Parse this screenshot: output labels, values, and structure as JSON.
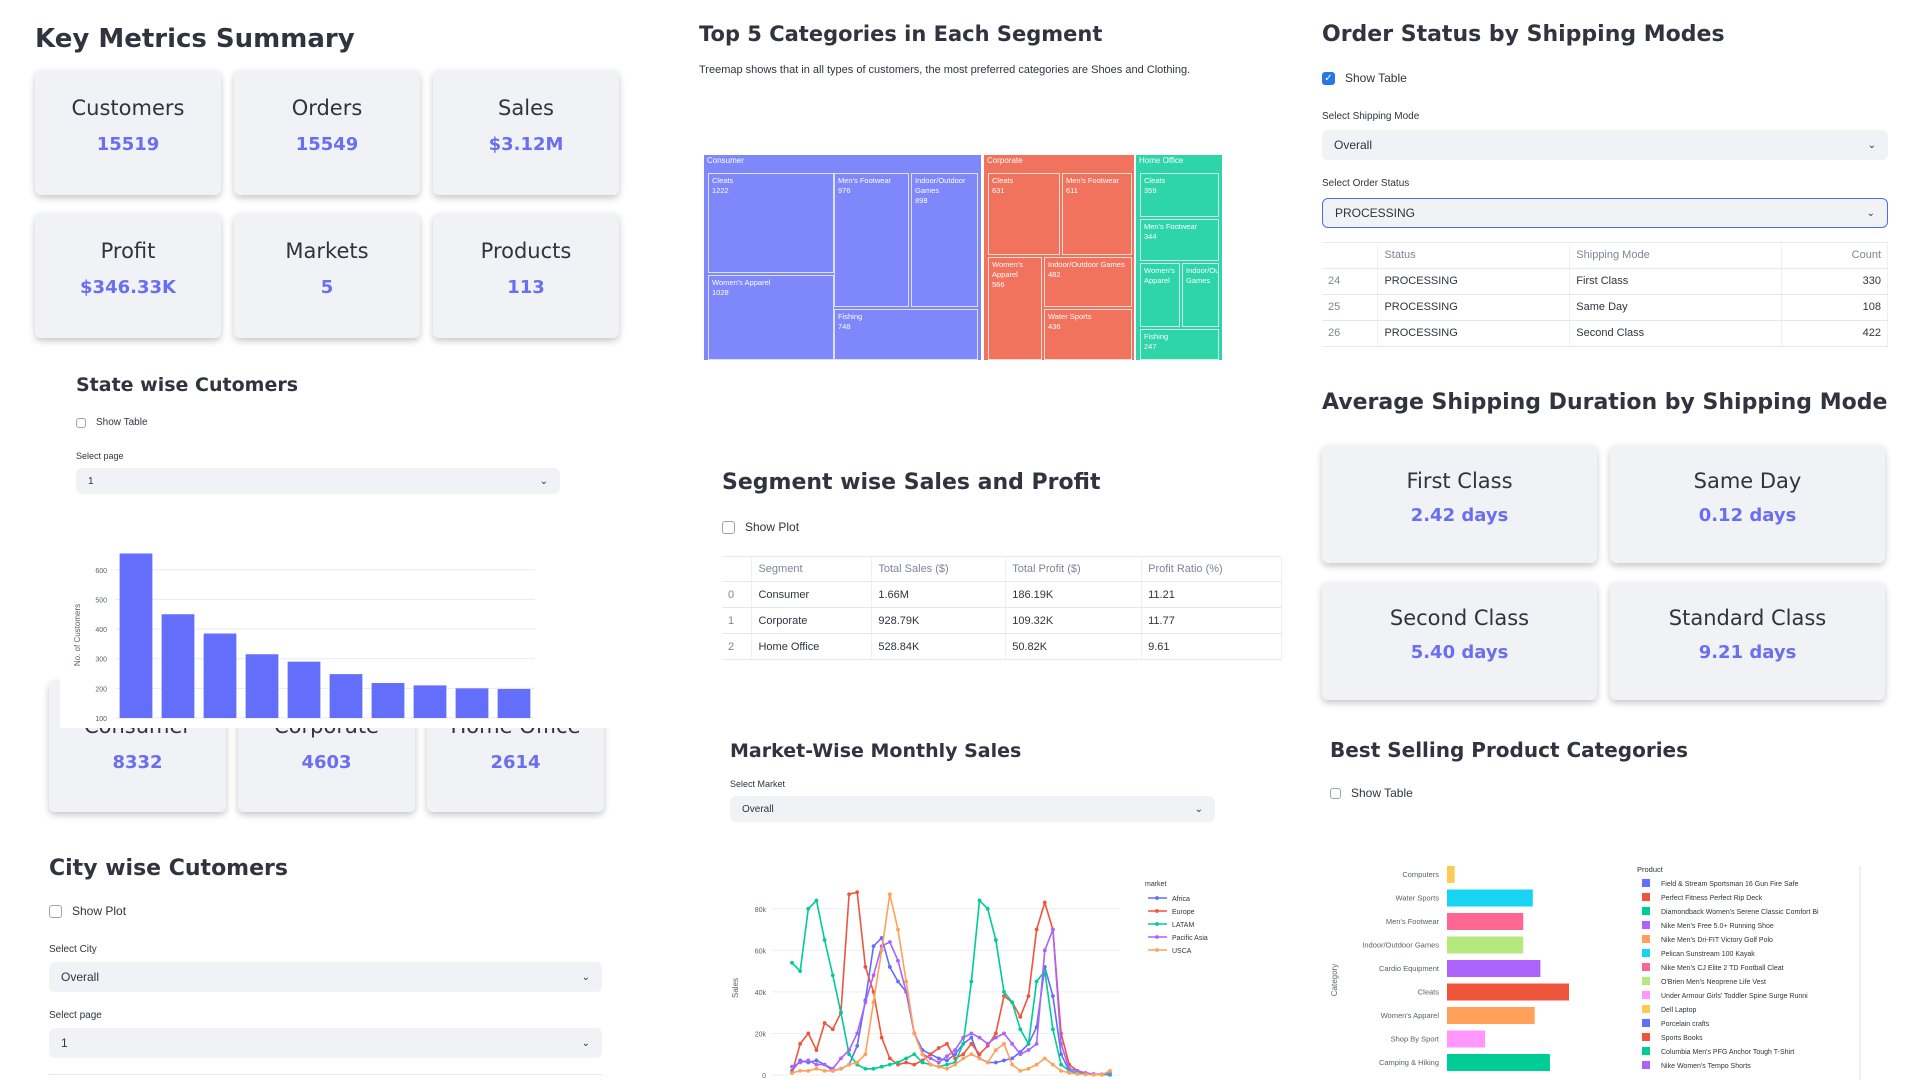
{
  "key_metrics": {
    "title": "Key Metrics Summary",
    "cards": [
      {
        "label": "Customers",
        "value": "15519"
      },
      {
        "label": "Orders",
        "value": "15549"
      },
      {
        "label": "Sales",
        "value": "$3.12M"
      },
      {
        "label": "Profit",
        "value": "$346.33K"
      },
      {
        "label": "Markets",
        "value": "5"
      },
      {
        "label": "Products",
        "value": "113"
      }
    ]
  },
  "state_customers": {
    "title": "State wise Cutomers",
    "show_table_label": "Show Table",
    "select_page_label": "Select page",
    "select_page_value": "1",
    "chart_data": {
      "type": "bar",
      "ylabel": "No. of Customers",
      "yticks": [
        "100",
        "200",
        "300",
        "400",
        "500",
        "600"
      ],
      "ylim": [
        100,
        660
      ],
      "values": [
        655,
        450,
        385,
        315,
        290,
        248,
        218,
        210,
        200,
        198
      ]
    }
  },
  "segment_cards": [
    {
      "label": "Consumer",
      "value": "8332"
    },
    {
      "label": "Corporate",
      "value": "4603"
    },
    {
      "label": "Home Office",
      "value": "2614"
    }
  ],
  "city_customers": {
    "title": "City wise Cutomers",
    "show_plot_label": "Show Plot",
    "select_city_label": "Select City",
    "select_city_value": "Overall",
    "select_page_label": "Select page",
    "select_page_value": "1"
  },
  "treemap": {
    "title": "Top 5 Categories in Each Segment",
    "description": "Treemap shows that in all types of customers, the most preferred categories are Shoes and Clothing.",
    "colors": {
      "Consumer": "#636efa",
      "Corporate": "#ef553b",
      "Home Office": "#00cc96"
    },
    "segments": [
      {
        "name": "Consumer",
        "cells": [
          {
            "label": "Cleats",
            "value": "1222"
          },
          {
            "label": "Men's Footwear",
            "value": "976"
          },
          {
            "label": "Indoor/Outdoor Games",
            "value": "898"
          },
          {
            "label": "Women's Apparel",
            "value": "1028"
          },
          {
            "label": "Fishing",
            "value": "748"
          }
        ]
      },
      {
        "name": "Corporate",
        "cells": [
          {
            "label": "Cleats",
            "value": "631"
          },
          {
            "label": "Men's Footwear",
            "value": "611"
          },
          {
            "label": "Women's Apparel",
            "value": "566"
          },
          {
            "label": "Indoor/Outdoor Games",
            "value": "482"
          },
          {
            "label": "Water Sports",
            "value": "436"
          }
        ]
      },
      {
        "name": "Home Office",
        "cells": [
          {
            "label": "Cleats",
            "value": "359"
          },
          {
            "label": "Men's Footwear",
            "value": "344"
          },
          {
            "label": "Women's Apparel",
            "value": ""
          },
          {
            "label": "Indoor/Outdoor Games",
            "value": ""
          },
          {
            "label": "Fishing",
            "value": "247"
          }
        ]
      }
    ]
  },
  "segment_sales": {
    "title": "Segment wise Sales and Profit",
    "show_plot_label": "Show Plot",
    "columns": [
      "",
      "Segment",
      "Total Sales ($)",
      "Total Profit ($)",
      "Profit Ratio (%)"
    ],
    "rows": [
      [
        "0",
        "Consumer",
        "1.66M",
        "186.19K",
        "11.21"
      ],
      [
        "1",
        "Corporate",
        "928.79K",
        "109.32K",
        "11.77"
      ],
      [
        "2",
        "Home Office",
        "528.84K",
        "50.82K",
        "9.61"
      ]
    ]
  },
  "market_sales": {
    "title": "Market-Wise Monthly Sales",
    "select_market_label": "Select Market",
    "select_market_value": "Overall",
    "chart_data": {
      "type": "line",
      "ylabel": "Sales",
      "yticks": [
        "0",
        "20k",
        "40k",
        "60k",
        "80k"
      ],
      "ylim": [
        0,
        90000
      ],
      "legend_title": "market",
      "series": [
        {
          "name": "Africa",
          "color": "#636efa",
          "values": [
            2000,
            7000,
            6000,
            7000,
            5000,
            2000,
            3000,
            5000,
            14000,
            36000,
            62000,
            66000,
            52000,
            45000,
            40000,
            20000,
            12000,
            10000,
            8000,
            7000,
            10000,
            15000,
            18000,
            8000,
            6000,
            6000,
            7000,
            8000,
            11000,
            15000,
            23000,
            52000,
            38000,
            10000,
            2000,
            1000,
            500,
            300,
            200,
            100
          ]
        },
        {
          "name": "Europe",
          "color": "#ef553b",
          "values": [
            1000,
            15000,
            20000,
            12000,
            25000,
            22000,
            30000,
            87000,
            88000,
            52000,
            40000,
            18000,
            8000,
            5000,
            6000,
            5000,
            7000,
            10000,
            13000,
            15000,
            8000,
            10000,
            15000,
            10000,
            14000,
            20000,
            38000,
            35000,
            28000,
            38000,
            70000,
            83000,
            70000,
            20000,
            5000,
            2000,
            500,
            300,
            200,
            100
          ]
        },
        {
          "name": "LATAM",
          "color": "#00cc96",
          "values": [
            54000,
            50000,
            80000,
            84000,
            65000,
            48000,
            30000,
            10000,
            5000,
            3000,
            3000,
            4000,
            5000,
            6000,
            8000,
            10000,
            6000,
            5000,
            4000,
            5000,
            6000,
            15000,
            45000,
            84000,
            80000,
            65000,
            40000,
            35000,
            22000,
            15000,
            45000,
            50000,
            22000,
            5000,
            2000,
            1000,
            500,
            300,
            200,
            100
          ]
        },
        {
          "name": "Pacific Asia",
          "color": "#ab63fa",
          "values": [
            4000,
            6000,
            7000,
            5000,
            5000,
            3000,
            8000,
            12000,
            20000,
            35000,
            48000,
            62000,
            64000,
            55000,
            40000,
            20000,
            10000,
            8000,
            6000,
            9000,
            12000,
            18000,
            20000,
            18000,
            15000,
            18000,
            20000,
            15000,
            10000,
            12000,
            15000,
            60000,
            70000,
            15000,
            3000,
            2000,
            1000,
            500,
            300,
            1000
          ]
        },
        {
          "name": "USCA",
          "color": "#ffa15a",
          "values": [
            1000,
            2000,
            2000,
            3000,
            2000,
            2000,
            3000,
            5000,
            6000,
            10000,
            35000,
            60000,
            87000,
            70000,
            45000,
            20000,
            10000,
            5000,
            4000,
            3000,
            5000,
            8000,
            10000,
            8000,
            6000,
            12000,
            15000,
            5000,
            2000,
            3000,
            5000,
            8000,
            5000,
            2000,
            1000,
            500,
            300,
            200,
            100,
            2000
          ]
        }
      ]
    }
  },
  "order_status": {
    "title": "Order Status by Shipping Modes",
    "show_table_label": "Show Table",
    "shipping_mode_label": "Select Shipping Mode",
    "shipping_mode_value": "Overall",
    "order_status_label": "Select Order Status",
    "order_status_value": "PROCESSING",
    "columns": [
      "",
      "Status",
      "Shipping Mode",
      "Count"
    ],
    "rows": [
      [
        "24",
        "PROCESSING",
        "First Class",
        "330"
      ],
      [
        "25",
        "PROCESSING",
        "Same Day",
        "108"
      ],
      [
        "26",
        "PROCESSING",
        "Second Class",
        "422"
      ]
    ]
  },
  "shipping_duration": {
    "title": "Average Shipping Duration by Shipping Mode",
    "cards": [
      {
        "label": "First Class",
        "value": "2.42 days"
      },
      {
        "label": "Same Day",
        "value": "0.12 days"
      },
      {
        "label": "Second Class",
        "value": "5.40 days"
      },
      {
        "label": "Standard Class",
        "value": "9.21 days"
      }
    ]
  },
  "best_categories": {
    "title": "Best Selling Product Categories",
    "show_table_label": "Show Table",
    "chart_data": {
      "type": "bar",
      "ylabel": "Category",
      "categories": [
        "Computers",
        "Water Sports",
        "Men's Footwear",
        "Indoor/Outdoor Games",
        "Cardio Equipment",
        "Cleats",
        "Women's Apparel",
        "Shop By Sport",
        "Camping & Hiking"
      ],
      "values": [
        8,
        90,
        80,
        80,
        98,
        128,
        92,
        40,
        108
      ],
      "colors": [
        "#fecb52",
        "#19d3f3",
        "#ff6692",
        "#b6e880",
        "#ab63fa",
        "#ef553b",
        "#ffa15a",
        "#ff97ff",
        "#00cc96"
      ],
      "legend_title": "Product",
      "legend": [
        {
          "name": "Field & Stream Sportsman 16 Gun Fire Safe",
          "color": "#636efa"
        },
        {
          "name": "Perfect Fitness Perfect Rip Deck",
          "color": "#ef553b"
        },
        {
          "name": "Diamondback Women's Serene Classic Comfort Bi",
          "color": "#00cc96"
        },
        {
          "name": "Nike Men's Free 5.0+ Running Shoe",
          "color": "#ab63fa"
        },
        {
          "name": "Nike Men's Dri-FIT Victory Golf Polo",
          "color": "#ffa15a"
        },
        {
          "name": "Pelican Sunstream 100 Kayak",
          "color": "#19d3f3"
        },
        {
          "name": "Nike Men's CJ Elite 2 TD Football Cleat",
          "color": "#ff6692"
        },
        {
          "name": "O'Brien Men's Neoprene Life Vest",
          "color": "#b6e880"
        },
        {
          "name": "Under Armour Girls' Toddler Spine Surge Runni",
          "color": "#ff97ff"
        },
        {
          "name": "Dell Laptop",
          "color": "#fecb52"
        },
        {
          "name": "Porcelain crafts",
          "color": "#636efa"
        },
        {
          "name": "Sports Books",
          "color": "#ef553b"
        },
        {
          "name": "Columbia Men's PFG Anchor Tough T-Shirt",
          "color": "#00cc96"
        },
        {
          "name": "Nike Women's Tempo Shorts",
          "color": "#ab63fa"
        }
      ]
    }
  }
}
